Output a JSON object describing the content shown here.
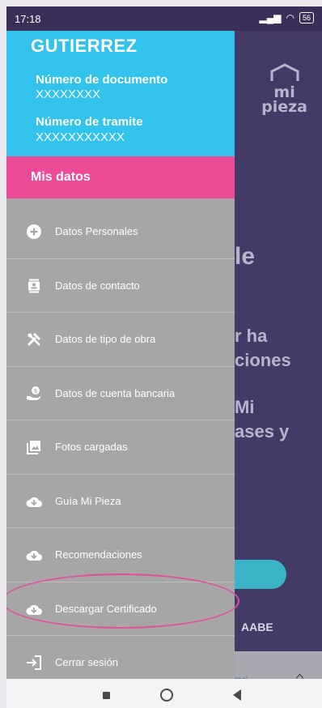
{
  "status_bar": {
    "time": "17:18",
    "battery": "56"
  },
  "background_app": {
    "logo_line1": "mi",
    "logo_line2": "pieza",
    "text_fragments": [
      "le",
      "r ha",
      "ciones",
      "Mi",
      "ases y"
    ],
    "brand": "AABE",
    "nav_fragment": "raci..."
  },
  "drawer": {
    "header": {
      "name": "GUTIERREZ",
      "document_label": "Número de documento",
      "document_value": "XXXXXXXX",
      "tramite_label": "Número de tramite",
      "tramite_value": "XXXXXXXXXXX"
    },
    "section_title": "Mis datos",
    "items": [
      {
        "label": "Datos Personales",
        "icon": "plus-circle-icon"
      },
      {
        "label": "Datos de contacto",
        "icon": "contact-card-icon"
      },
      {
        "label": "Datos de tipo de obra",
        "icon": "tools-icon"
      },
      {
        "label": "Datos de cuenta bancaria",
        "icon": "hand-money-icon"
      },
      {
        "label": "Fotos cargadas",
        "icon": "photos-icon"
      },
      {
        "label": "Guía Mi Pieza",
        "icon": "cloud-download-icon"
      },
      {
        "label": "Recomendaciones",
        "icon": "cloud-download-icon"
      },
      {
        "label": "Descargar Certificado",
        "icon": "cloud-download-icon"
      },
      {
        "label": "Cerrar sesión",
        "icon": "logout-icon"
      }
    ]
  },
  "colors": {
    "header_cyan": "#31c3ec",
    "section_pink": "#ec4c97",
    "drawer_gray": "#a6a6a6",
    "bg_purple": "#433a66"
  }
}
